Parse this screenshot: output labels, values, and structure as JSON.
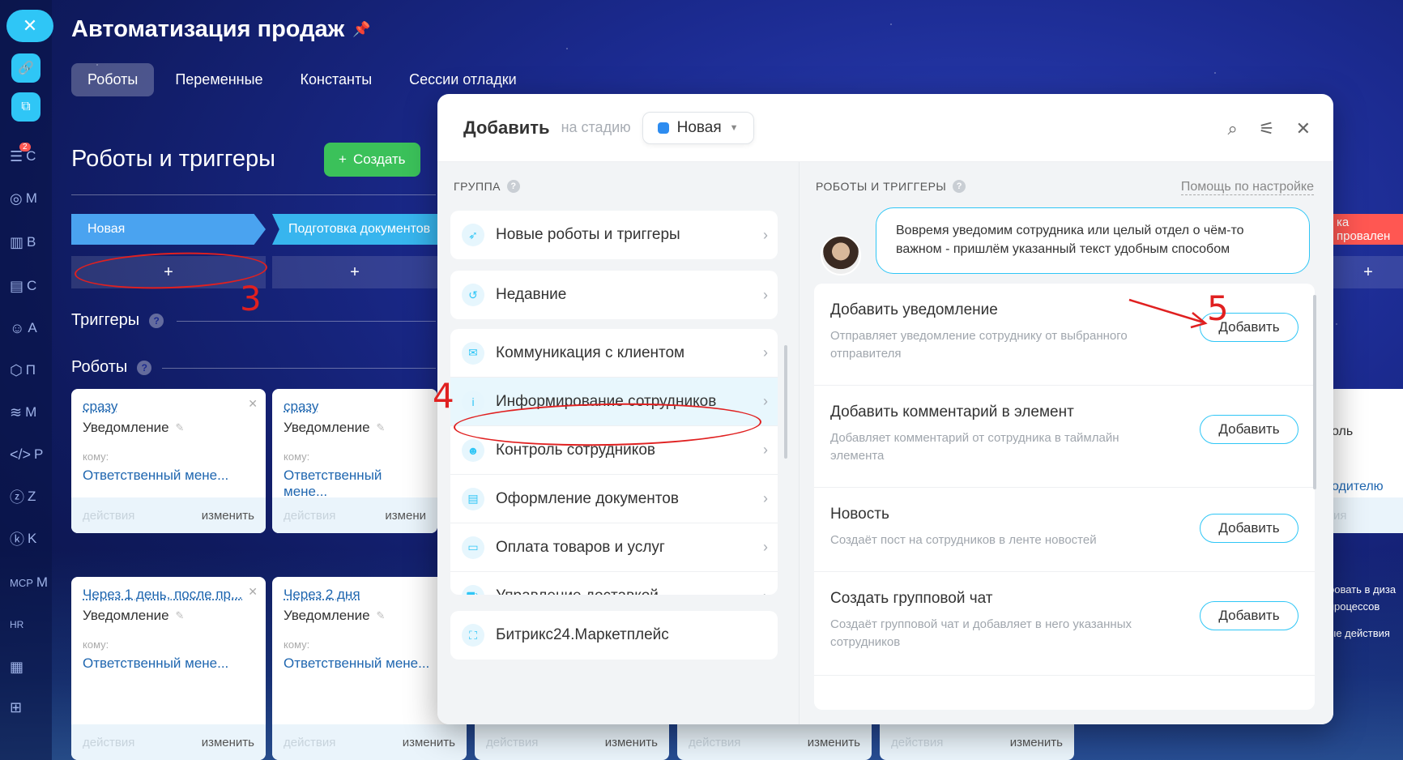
{
  "page": {
    "title": "Автоматизация продаж",
    "tabs": [
      "Роботы",
      "Переменные",
      "Константы",
      "Сессии отладки"
    ],
    "section_title": "Роботы и триггеры",
    "create_label": "Создать"
  },
  "rail": {
    "letters": [
      "C",
      "M",
      "B",
      "C",
      "A",
      "П",
      "M",
      "P",
      "Z",
      "K",
      "M"
    ],
    "badge": "2",
    "codes": [
      "MCP",
      "HR"
    ]
  },
  "stages": {
    "new": "Новая",
    "prep": "Подготовка документов",
    "fail": "ка провален"
  },
  "rows": {
    "triggers": "Триггеры",
    "robots": "Роботы"
  },
  "cards": [
    {
      "when": "сразу",
      "type": "Уведомление",
      "to": "кому:",
      "resp": "Ответственный мене...",
      "actions": "действия",
      "change": "изменить"
    },
    {
      "when": "сразу",
      "type": "Уведомление",
      "to": "кому:",
      "resp": "Ответственный мене...",
      "actions": "действия",
      "change": "измени"
    },
    {
      "when": "Через 1 день, после пр...",
      "type": "Уведомление",
      "to": "кому:",
      "resp": "Ответственный мене...",
      "actions": "действия",
      "change": "изменить"
    },
    {
      "when": "Через 2 дня",
      "type": "Уведомление",
      "to": "кому:",
      "resp": "Ответственный мене...",
      "actions": "действия",
      "change": "изменить"
    }
  ],
  "strips": [
    {
      "actions": "действия",
      "change": "изменить"
    },
    {
      "actions": "действия",
      "change": "изменить"
    },
    {
      "actions": "действия",
      "change": "изменить"
    }
  ],
  "right_partial": {
    "line1": "оль",
    "line2": "одителю",
    "line3": "ия",
    "line4": "ровать в диза",
    "line5": "процессов",
    "line6": "ые действия"
  },
  "annotations": {
    "n3": "3",
    "n4": "4",
    "n5": "5"
  },
  "modal": {
    "title": "Добавить",
    "stage_prefix": "на стадию",
    "stage_value": "Новая",
    "group_caption": "ГРУППА",
    "robots_caption": "РОБОТЫ И ТРИГГЕРЫ",
    "help_link": "Помощь по настройке",
    "groups_top": [
      {
        "icon": "rocket-icon",
        "label": "Новые роботы и триггеры"
      },
      {
        "icon": "history-icon",
        "label": "Недавние"
      }
    ],
    "groups_main": [
      {
        "icon": "chat-icon",
        "label": "Коммуникация с клиентом"
      },
      {
        "icon": "info-icon",
        "label": "Информирование сотрудников"
      },
      {
        "icon": "users-icon",
        "label": "Контроль сотрудников"
      },
      {
        "icon": "document-icon",
        "label": "Оформление документов"
      },
      {
        "icon": "wallet-icon",
        "label": "Оплата товаров и услуг"
      },
      {
        "icon": "truck-icon",
        "label": "Управление доставкой"
      }
    ],
    "group_market": {
      "icon": "market-icon",
      "label": "Битрикс24.Маркетплейс"
    },
    "bubble": "Вовремя уведомим сотрудника или целый отдел о чём-то важном - пришлём указанный текст удобным способом",
    "robots": [
      {
        "title": "Добавить уведомление",
        "desc": "Отправляет уведомление сотруднику от выбранного отправителя",
        "btn": "Добавить"
      },
      {
        "title": "Добавить комментарий в элемент",
        "desc": "Добавляет комментарий от сотрудника в таймлайн элемента",
        "btn": "Добавить"
      },
      {
        "title": "Новость",
        "desc": "Создаёт пост на сотрудников в ленте новостей",
        "btn": "Добавить"
      },
      {
        "title": "Создать групповой чат",
        "desc": "Создаёт групповой чат и добавляет в него указанных сотрудников",
        "btn": "Добавить"
      }
    ]
  }
}
